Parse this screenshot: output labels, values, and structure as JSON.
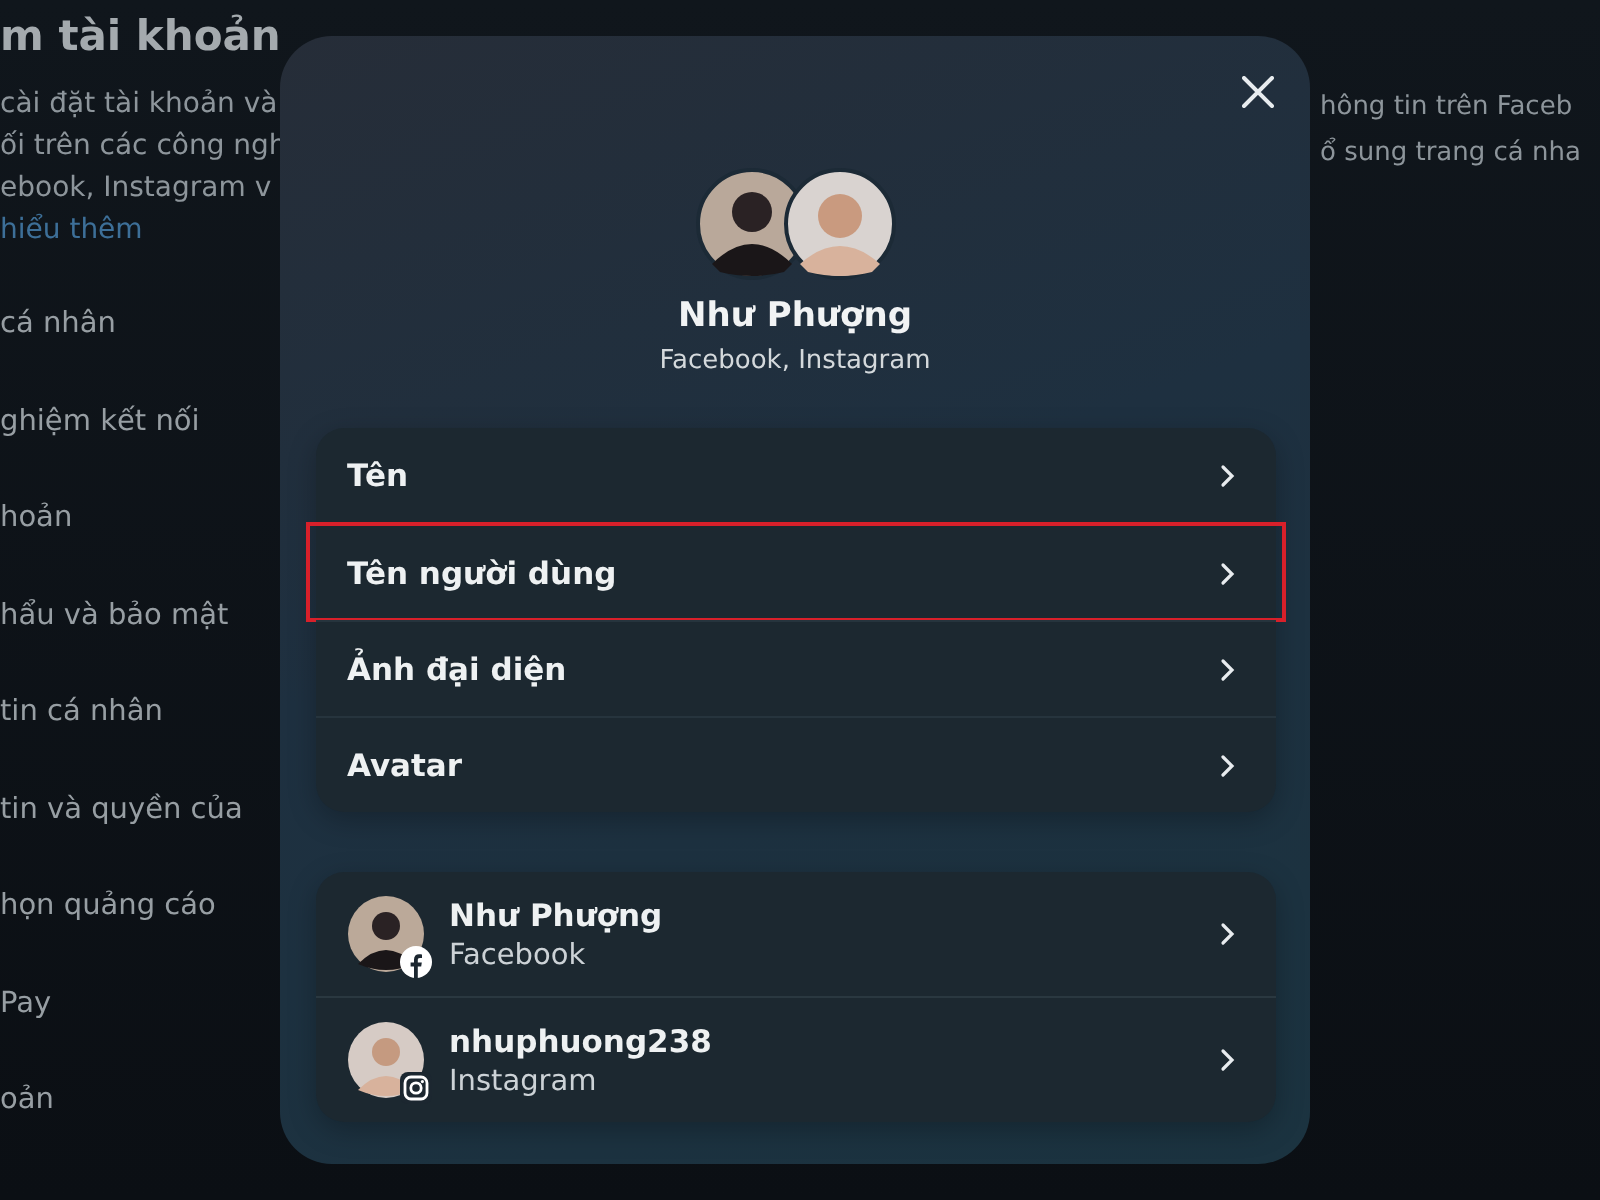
{
  "background": {
    "title": "m tài khoản",
    "intro": [
      "cài đặt tài khoản và",
      "ối trên các công ngh",
      "ebook, Instagram v"
    ],
    "link": "hiểu thêm",
    "menu": [
      "cá nhân",
      "ghiệm kết nối",
      "hoản",
      "hẩu và bảo mật",
      "tin cá nhân",
      "tin và quyền của",
      "họn quảng cáo",
      "Pay",
      "oản"
    ],
    "right_text": [
      "hông tin trên Faceb",
      "ổ sung trang cá nha"
    ]
  },
  "dialog": {
    "profile": {
      "name": "Như Phượng",
      "subtitle": "Facebook, Instagram"
    },
    "items": [
      {
        "label": "Tên",
        "highlighted": false
      },
      {
        "label": "Tên người dùng",
        "highlighted": true
      },
      {
        "label": "Ảnh đại diện",
        "highlighted": false
      },
      {
        "label": "Avatar",
        "highlighted": false
      }
    ],
    "accounts": [
      {
        "name": "Như Phượng",
        "platform": "Facebook",
        "kind": "facebook"
      },
      {
        "name": "nhuphuong238",
        "platform": "Instagram",
        "kind": "instagram"
      }
    ]
  }
}
